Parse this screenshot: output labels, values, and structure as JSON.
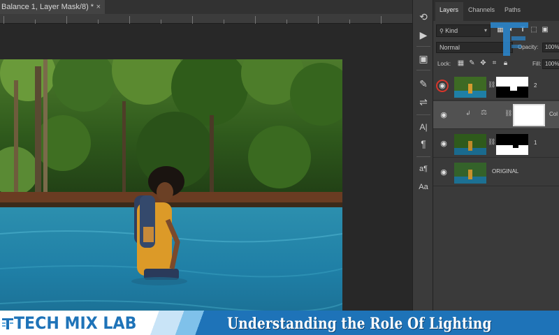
{
  "document": {
    "tab_title": "Balance 1, Layer Mask/8) *",
    "close_symbol": "×"
  },
  "tools": [
    {
      "icon": "history-brush-icon",
      "glyph": "⟲"
    },
    {
      "icon": "play-icon",
      "glyph": "▶"
    },
    {
      "icon": "layer-comps-icon",
      "glyph": "▣"
    },
    {
      "icon": "brush-icon",
      "glyph": "✎"
    },
    {
      "icon": "adjustments-icon",
      "glyph": "⇌"
    },
    {
      "icon": "character-icon",
      "glyph": "A|"
    },
    {
      "icon": "paragraph-icon",
      "glyph": "¶"
    },
    {
      "icon": "character-styles-icon",
      "glyph": "a¶"
    },
    {
      "icon": "paragraph-styles-icon",
      "glyph": "Aa"
    }
  ],
  "panel": {
    "tabs": [
      "Layers",
      "Channels",
      "Paths"
    ],
    "active_tab": "Layers",
    "filter_kind": "Kind",
    "blend_mode": "Normal",
    "opacity_label": "Opacity:",
    "opacity_value": "100%",
    "lock_label": "Lock:",
    "fill_label": "Fill:",
    "fill_value": "100%",
    "layers": [
      {
        "name": "2",
        "selected": false,
        "has_mask": true
      },
      {
        "name": "Col",
        "selected": true,
        "has_mask": true
      },
      {
        "name": "1",
        "selected": false,
        "has_mask": true
      },
      {
        "name": "ORIGINAL",
        "selected": false,
        "has_mask": false
      }
    ]
  },
  "banner": {
    "brand_tech": "TECH",
    "brand_mix": "MIX",
    "brand_lab": "LAB",
    "headline": "Understanding the Role Of Lighting"
  },
  "colors": {
    "accent": "#1e73b8",
    "highlight": "#d8352a"
  }
}
